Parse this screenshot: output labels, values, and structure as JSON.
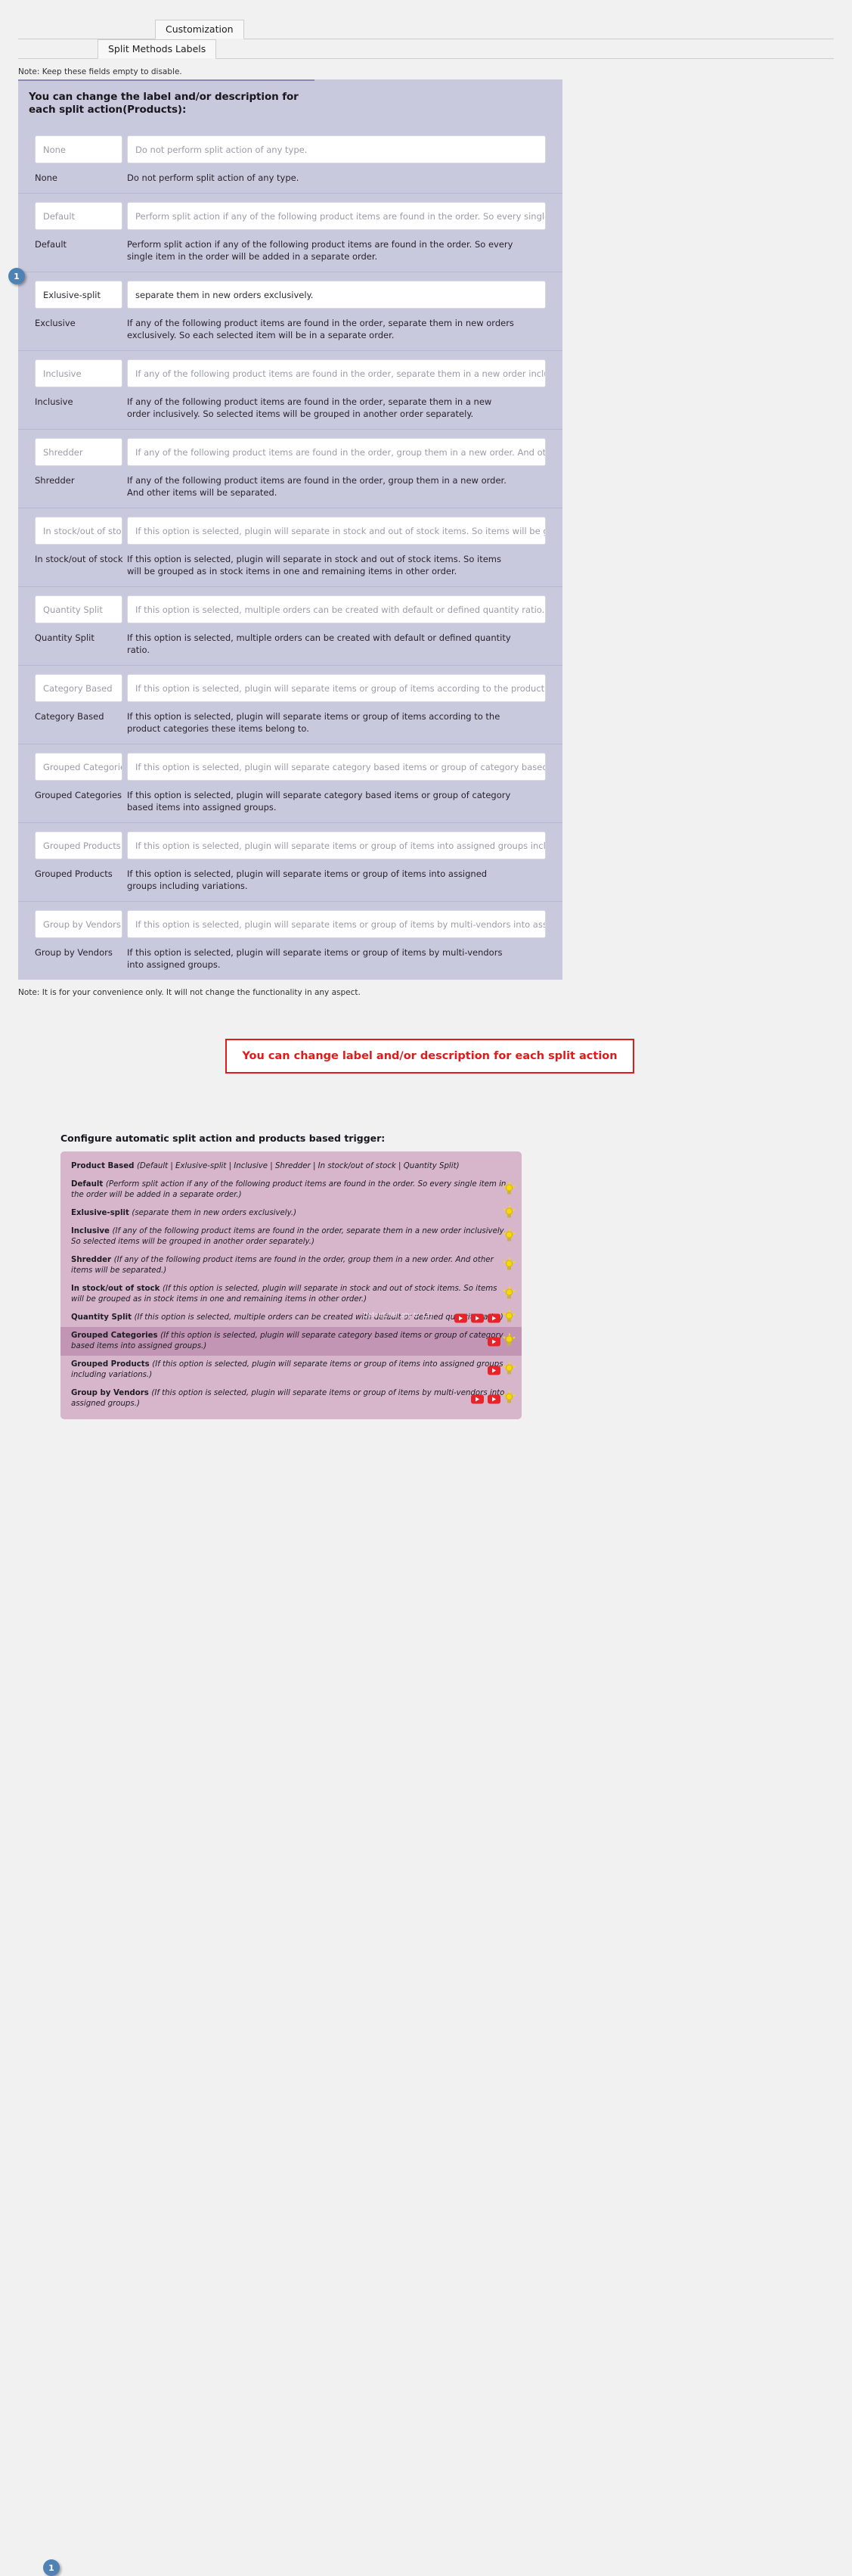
{
  "tabs": {
    "primary": "Customization",
    "secondary": "Split Methods Labels"
  },
  "notes": {
    "top": "Note: Keep these fields empty to disable.",
    "bottom": "Note: It is for your convenience only. It will not change the functionality in any aspect."
  },
  "panel": {
    "heading": "You can change the label and/or description for each split action(Products):",
    "rows": [
      {
        "label_placeholder": "None",
        "label_value": "",
        "desc_placeholder": "Do not perform split action of any type.",
        "desc_value": "",
        "read_label": "None",
        "read_desc": "Do not perform split action of any type."
      },
      {
        "label_placeholder": "Default",
        "label_value": "",
        "desc_placeholder": "Perform split action if any of the following product items are found in the order. So every single item in the order will be adde",
        "desc_value": "",
        "read_label": "Default",
        "read_desc": "Perform split action if any of the following product items are found in the order. So every single item in the order will be added in a separate order."
      },
      {
        "label_placeholder": "",
        "label_value": "Exlusive-split",
        "desc_placeholder": "",
        "desc_value": "separate them in new orders exclusively.",
        "read_label": "Exclusive",
        "read_desc": "If any of the following product items are found in the order, separate them in new orders exclusively. So each selected item will be in a separate order.",
        "badge": "1"
      },
      {
        "label_placeholder": "Inclusive",
        "label_value": "",
        "desc_placeholder": "If any of the following product items are found in the order, separate them in a new order inclusively. So selected items will b",
        "desc_value": "",
        "read_label": "Inclusive",
        "read_desc": "If any of the following product items are found in the order, separate them in a new order inclusively. So selected items will be grouped in another order separately."
      },
      {
        "label_placeholder": "Shredder",
        "label_value": "",
        "desc_placeholder": "If any of the following product items are found in the order, group them in a new order. And other items will be separated.",
        "desc_value": "",
        "read_label": "Shredder",
        "read_desc": "If any of the following product items are found in the order, group them in a new order. And other items will be separated."
      },
      {
        "label_placeholder": "In stock/out of stock",
        "label_value": "",
        "desc_placeholder": "If this option is selected, plugin will separate in stock and out of stock items. So items will be grouped as in stock items in one",
        "desc_value": "",
        "read_label": "In stock/out of stock",
        "read_desc": "If this option is selected, plugin will separate in stock and out of stock items. So items will be grouped as in stock items in one and remaining items in other order."
      },
      {
        "label_placeholder": "Quantity Split",
        "label_value": "",
        "desc_placeholder": "If this option is selected, multiple orders can be created with default or defined quantity ratio.",
        "desc_value": "",
        "read_label": "Quantity Split",
        "read_desc": "If this option is selected, multiple orders can be created with default or defined quantity ratio."
      },
      {
        "label_placeholder": "Category Based",
        "label_value": "",
        "desc_placeholder": "If this option is selected, plugin will separate items or group of items according to the product categories these items belong",
        "desc_value": "",
        "read_label": "Category Based",
        "read_desc": "If this option is selected, plugin will separate items or group of items according to the product categories these items belong to."
      },
      {
        "label_placeholder": "Grouped Categories",
        "label_value": "",
        "desc_placeholder": "If this option is selected, plugin will separate category based items or group of category based items into assigned groups.",
        "desc_value": "",
        "read_label": "Grouped Categories",
        "read_desc": "If this option is selected, plugin will separate category based items or group of category based items into assigned groups."
      },
      {
        "label_placeholder": "Grouped Products",
        "label_value": "",
        "desc_placeholder": "If this option is selected, plugin will separate items or group of items into assigned groups including variations.",
        "desc_value": "",
        "read_label": "Grouped Products",
        "read_desc": "If this option is selected, plugin will separate items or group of items into assigned groups including variations."
      },
      {
        "label_placeholder": "Group by Vendors",
        "label_value": "",
        "desc_placeholder": "If this option is selected, plugin will separate items or group of items by multi-vendors into assigned groups.",
        "desc_value": "",
        "read_label": "Group by Vendors",
        "read_desc": "If this option is selected, plugin will separate items or group of items by multi-vendors into assigned groups."
      }
    ]
  },
  "callout": {
    "text": "You can change label and/or description for each split action",
    "border_color": "#e01b1b",
    "text_color": "#e01b1b"
  },
  "bottom": {
    "badge": "1",
    "title": "Configure automatic split action and products based trigger:",
    "lines": [
      {
        "name": "Product Based",
        "desc": "(Default | Exlusive-split | Inclusive | Shredder | In stock/out of stock | Quantity Split)",
        "highlight": false,
        "youtube": 0,
        "bulb": false,
        "tag": ""
      },
      {
        "name": "Default",
        "desc": "(Perform split action if any of the following product items are found in the order. So every single item in the order will be added in a separate order.)",
        "highlight": false,
        "youtube": 0,
        "bulb": true,
        "tag": ""
      },
      {
        "name": "Exlusive-split",
        "desc": "(separate them in new orders exclusively.)",
        "highlight": false,
        "youtube": 0,
        "bulb": true,
        "tag": ""
      },
      {
        "name": "Inclusive",
        "desc": "(If any of the following product items are found in the order, separate them in a new order inclusively. So selected items will be grouped in another order separately.)",
        "highlight": false,
        "youtube": 0,
        "bulb": true,
        "tag": ""
      },
      {
        "name": "Shredder",
        "desc": "(If any of the following product items are found in the order, group them in a new order. And other items will be separated.)",
        "highlight": false,
        "youtube": 0,
        "bulb": true,
        "tag": ""
      },
      {
        "name": "In stock/out of stock",
        "desc": "(If this option is selected, plugin will separate in stock and out of stock items. So items will be grouped as in stock items in one and remaining items in other order.)",
        "highlight": false,
        "youtube": 0,
        "bulb": true,
        "tag": ""
      },
      {
        "name": "Quantity Split",
        "desc": "(If this option is selected, multiple orders can be created with default or defined quantity ratio.)",
        "highlight": false,
        "youtube": 3,
        "bulb": true,
        "tag": "Default (All qty to x1)"
      },
      {
        "name": "Grouped Categories",
        "desc": "(If this option is selected, plugin will separate category based items or group of category based items into assigned groups.)",
        "highlight": true,
        "youtube": 1,
        "bulb": true,
        "tag": ""
      },
      {
        "name": "Grouped Products",
        "desc": "(If this option is selected, plugin will separate items or group of items into assigned groups including variations.)",
        "highlight": false,
        "youtube": 1,
        "bulb": true,
        "tag": ""
      },
      {
        "name": "Group by Vendors",
        "desc": "(If this option is selected, plugin will separate items or group of items by multi-vendors into assigned groups.)",
        "highlight": false,
        "youtube": 2,
        "bulb": true,
        "tag": ""
      }
    ]
  }
}
